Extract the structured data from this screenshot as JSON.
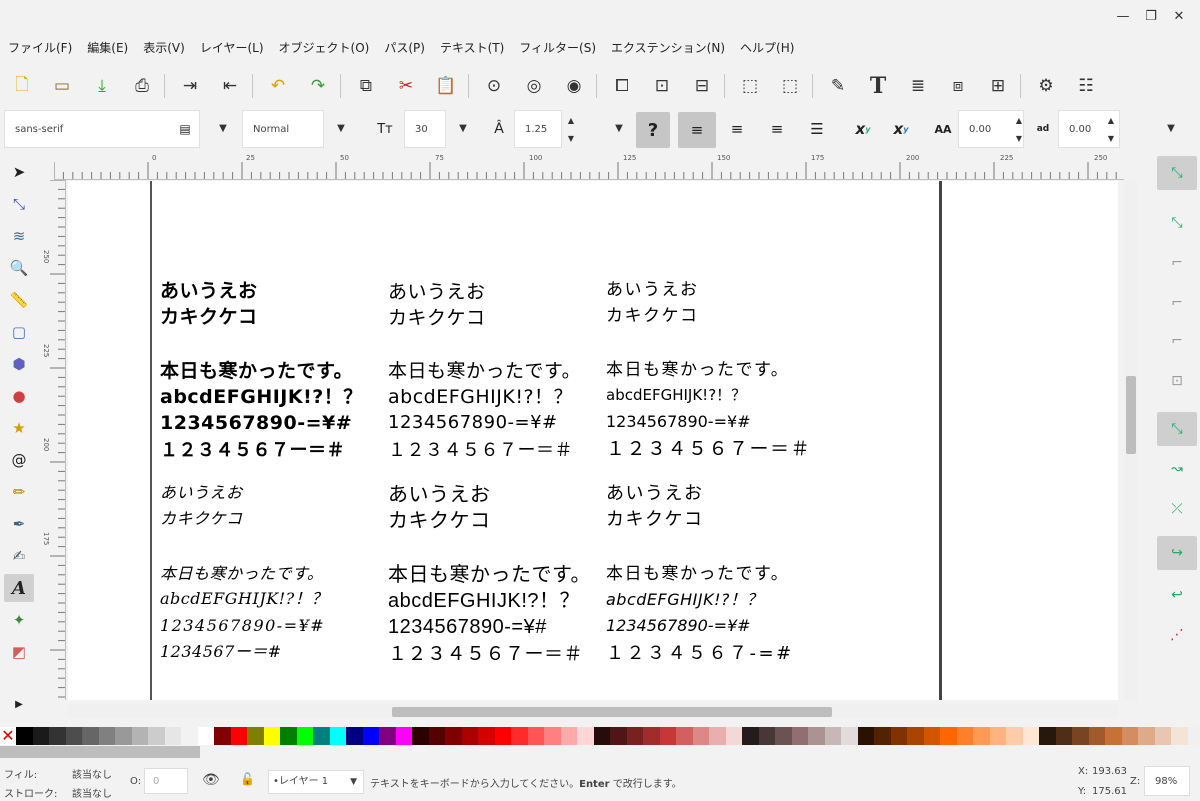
{
  "menu": [
    "ファイル(F)",
    "編集(E)",
    "表示(V)",
    "レイヤー(L)",
    "オブジェクト(O)",
    "パス(P)",
    "テキスト(T)",
    "フィルター(S)",
    "エクステンション(N)",
    "ヘルプ(H)"
  ],
  "text_toolbar": {
    "font_family": "sans-serif",
    "font_style": "Normal",
    "font_size": "30",
    "line_spacing": "1.25",
    "letter_spacing": "0.00",
    "word_spacing": "0.00",
    "help_glyph": "?",
    "sup_label": "x",
    "sub_label": "x",
    "aa_label": "AA"
  },
  "rulers": {
    "h": [
      "0",
      "25",
      "50",
      "75",
      "100",
      "125",
      "150",
      "175",
      "200",
      "225",
      "250"
    ],
    "v": [
      "250",
      "225",
      "200",
      "175"
    ]
  },
  "canvas": {
    "col1_top": [
      "あいうえお",
      "カキクケコ",
      "本日も寒かったです。",
      "abcdEFGHIJK!?！？",
      "1234567890-=¥#",
      "１２３４５６７ー＝＃"
    ],
    "col2_top": [
      "あいうえお",
      "カキクケコ",
      "本日も寒かったです。",
      "abcdEFGHIJK!?！？",
      "1234567890-=¥#",
      "１２３４５６７ー＝＃"
    ],
    "col3_top": [
      "あいうえお",
      "カキクケコ",
      "本日も寒かったです。",
      "abcdEFGHIJK!?！？",
      "1234567890-=¥#",
      "１２３４５６７ー＝＃"
    ],
    "col1_bottom": [
      "あいうえお",
      "カキクケコ",
      "本日も寒かったです。",
      "abcdEFGHIJK!?！？",
      "1234567890-=¥#",
      "1234567ー＝#"
    ],
    "col2_bottom": [
      "あいうえお",
      "カキクケコ",
      "本日も寒かったです。",
      "abcdEFGHIJK!?！？",
      "1234567890-=¥#",
      "１２３４５６７ー＝＃"
    ],
    "col3_bottom": [
      "あいうえお",
      "カキクケコ",
      "本日も寒かったです。",
      "abcdEFGHIJK!?！？",
      "1234567890-=¥#",
      "１２３４５６７-=#"
    ]
  },
  "palette": [
    "#000000",
    "#1a1a1a",
    "#333333",
    "#4d4d4d",
    "#666666",
    "#808080",
    "#999999",
    "#b3b3b3",
    "#cccccc",
    "#e6e6e6",
    "#f2f2f2",
    "#ffffff",
    "#800000",
    "#ff0000",
    "#808000",
    "#ffff00",
    "#008000",
    "#00ff00",
    "#008080",
    "#00ffff",
    "#000080",
    "#0000ff",
    "#800080",
    "#ff00ff",
    "#2b0000",
    "#550000",
    "#800000",
    "#aa0000",
    "#d40000",
    "#ff0000",
    "#ff2a2a",
    "#ff5555",
    "#ff8080",
    "#ffaaaa",
    "#ffd5d5",
    "#280b0b",
    "#501616",
    "#782121",
    "#a02c2c",
    "#c83737",
    "#d35f5f",
    "#de8787",
    "#e9afaf",
    "#f4d7d7",
    "#241c1c",
    "#483737",
    "#6c5353",
    "#916f6f",
    "#ac9393",
    "#c8b7b7",
    "#e3dbdb",
    "#2b1100",
    "#552200",
    "#803300",
    "#aa4400",
    "#d45500",
    "#ff6600",
    "#ff7f2a",
    "#ff9955",
    "#ffb380",
    "#ffccaa",
    "#ffe6d5",
    "#28170b",
    "#502d16",
    "#784421",
    "#a05a2c",
    "#c87137",
    "#d38d5f",
    "#deaa87",
    "#e9c6af",
    "#f4e3d7",
    "#f0f0f0"
  ],
  "status": {
    "fill_label": "フィル:",
    "fill_value": "該当なし",
    "stroke_label": "ストローク:",
    "stroke_value": "該当なし",
    "opacity_label": "O:",
    "opacity_value": "0",
    "layer": "•レイヤー 1",
    "message_pre": "テキストをキーボードから入力してください。",
    "message_bold": "Enter",
    "message_post": " で改行します。",
    "x_label": "X:",
    "x_value": "193.63",
    "y_label": "Y:",
    "y_value": "175.61",
    "z_label": "Z:",
    "zoom": "98%"
  }
}
